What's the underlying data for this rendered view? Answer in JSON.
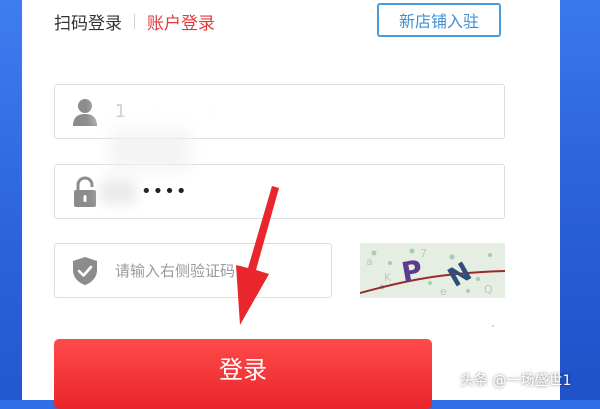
{
  "tabs": {
    "qr_login": "扫码登录",
    "account_login": "账户登录"
  },
  "join_button": "新店铺入驻",
  "username": {
    "value": "1"
  },
  "password": {
    "value": "••••"
  },
  "captcha_input": {
    "placeholder": "请输入右侧验证码"
  },
  "captcha_text": "PN",
  "login_button": "登录",
  "watermark": "头条 @一场盛世1",
  "colors": {
    "accent_red": "#e4393c",
    "join_blue": "#4a9bdc",
    "login_red": "#f0302f",
    "background_blue": "#2f6fe8"
  }
}
